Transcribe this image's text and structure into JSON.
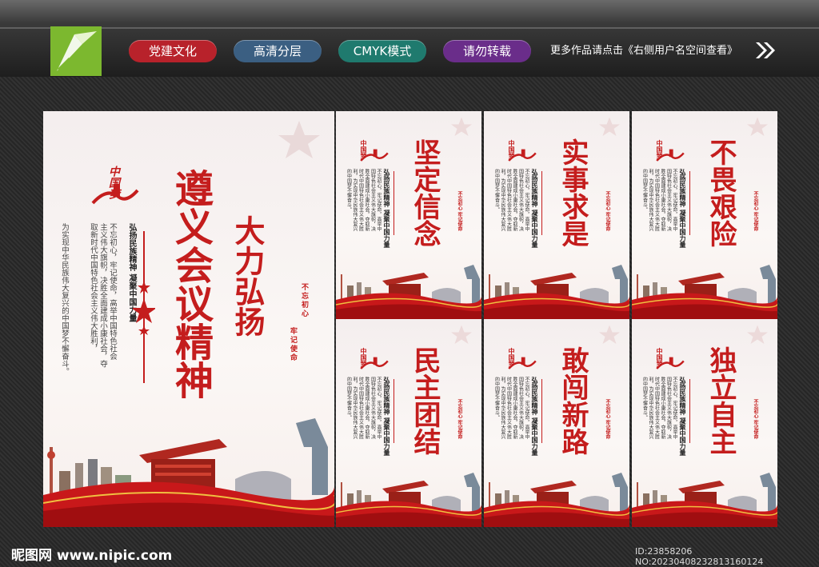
{
  "header": {
    "tags": [
      {
        "label": "党建文化",
        "color": "#b8222b"
      },
      {
        "label": "高清分层",
        "color": "#3b5f82"
      },
      {
        "label": "CMYK模式",
        "color": "#1f7a6e"
      },
      {
        "label": "请勿转载",
        "color": "#6a2d8a"
      }
    ],
    "note": "更多作品请点击《右侧用户名空间查看》"
  },
  "main_poster": {
    "title_line1": "遵义会议精神",
    "title_line2": "大力弘扬",
    "subtitle": "弘扬民族精神 凝聚中国力量",
    "body_col1": "不忘初心，牢记使命，高举中国特色社会",
    "body_col2": "取新时代中国特色社会主义伟大胜利，",
    "body_col3": "为实现中华民族伟大复兴的中国梦不懈奋斗。",
    "body_col0": "主义伟大旗帜，决胜全面建成小康社会，夺",
    "seal1": "不忘初心",
    "seal2": "牢记使命",
    "logo_text": "中国梦"
  },
  "small_posters": [
    {
      "title": "坚定信念"
    },
    {
      "title": "实事求是"
    },
    {
      "title": "不畏艰险"
    },
    {
      "title": "民主团结"
    },
    {
      "title": "敢闯新路"
    },
    {
      "title": "独立自主"
    }
  ],
  "small_common": {
    "subtitle": "弘扬民族精神 凝聚中国力量",
    "body": "不忘初心，牢记使命，高举中国特色社会主义伟大旗帜，决胜全面建成小康社会，夺取新时代中国特色社会主义伟大胜利，为实现中华民族伟大复兴的中国梦不懈奋斗。",
    "seal": "不忘初心 牢记使命",
    "logo_text": "中国梦"
  },
  "footer": {
    "watermark": "昵图网 www.nipic.com",
    "id": "ID:23858206 NO:20230408232813160124"
  }
}
